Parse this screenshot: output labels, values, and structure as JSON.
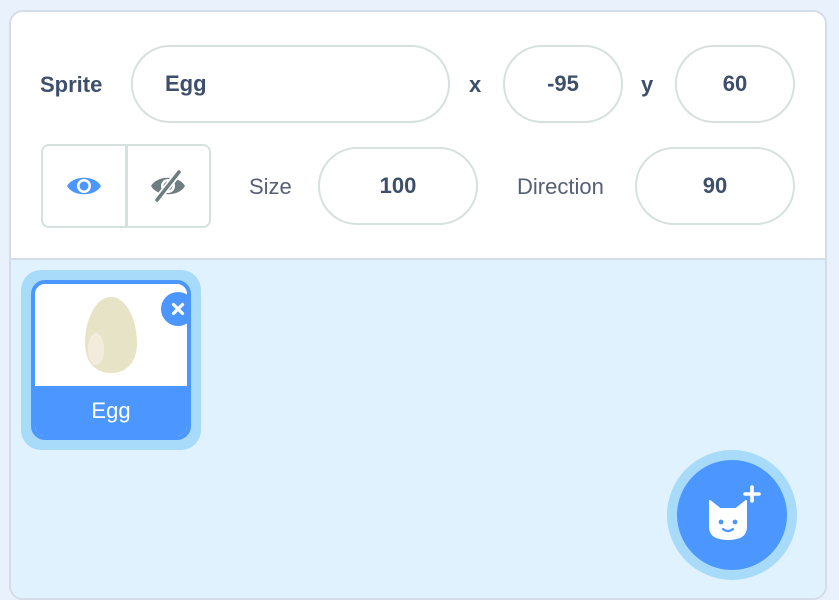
{
  "sprite_info": {
    "sprite_label": "Sprite",
    "name_value": "Egg",
    "x_label": "x",
    "x_value": "-95",
    "y_label": "y",
    "y_value": "60",
    "size_label": "Size",
    "size_value": "100",
    "direction_label": "Direction",
    "direction_value": "90",
    "show_icon": "eye-icon",
    "hide_icon": "eye-slash-icon",
    "visible": true
  },
  "sprite_list": {
    "items": [
      {
        "name": "Egg",
        "selected": true
      }
    ]
  },
  "colors": {
    "accent": "#4c97ff",
    "accent_halo": "#a8dbfa",
    "list_background": "#e0f2fd",
    "text": "#3d4f6b"
  }
}
